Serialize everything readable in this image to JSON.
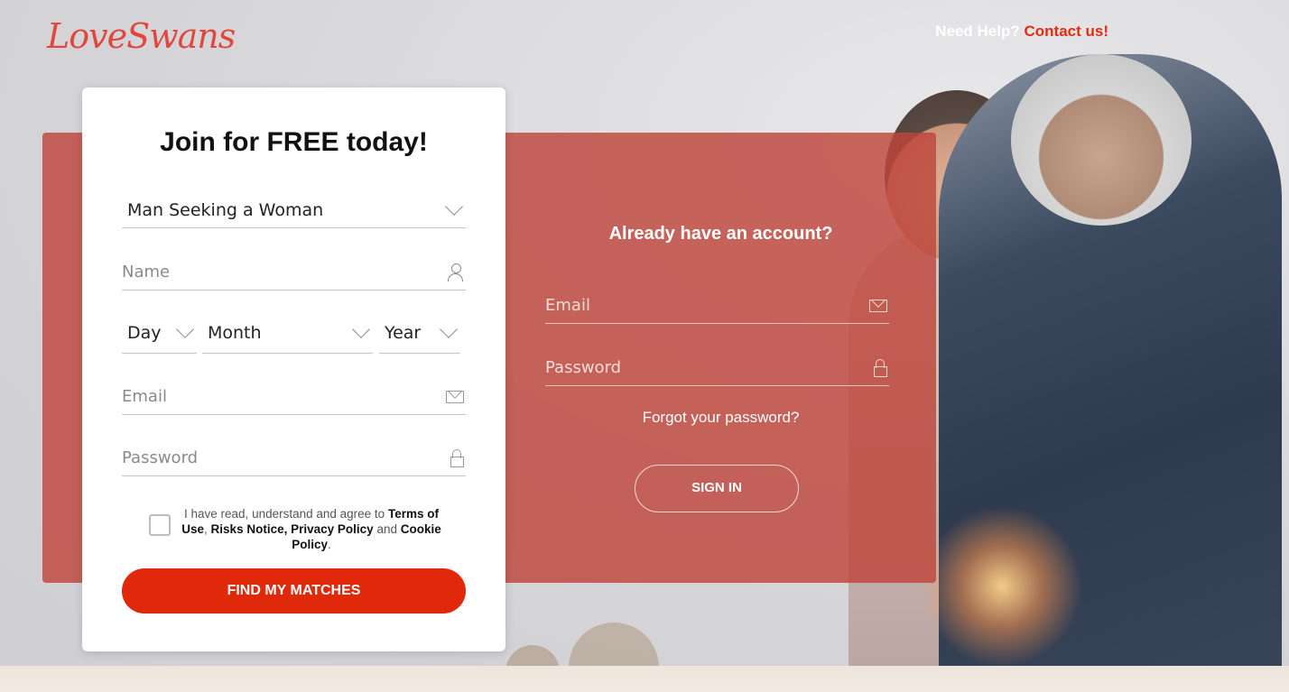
{
  "brand": {
    "logo_text": "LoveSwans"
  },
  "header": {
    "help_text": "Need Help?",
    "contact_link": "Contact us!"
  },
  "signup": {
    "title": "Join for FREE today!",
    "seeking_value": "Man Seeking a Woman",
    "name_placeholder": "Name",
    "day_value": "Day",
    "month_value": "Month",
    "year_value": "Year",
    "email_placeholder": "Email",
    "password_placeholder": "Password",
    "agree": {
      "prefix": "I have read, understand and agree to",
      "terms": "Terms of Use",
      "sep1": ",",
      "risks": "Risks Notice,",
      "privacy": "Privacy Policy",
      "and": "and",
      "cookie": "Cookie Policy",
      "end": "."
    },
    "submit_label": "FIND MY MATCHES"
  },
  "signin": {
    "title": "Already have an account?",
    "email_placeholder": "Email",
    "password_placeholder": "Password",
    "forgot_link": "Forgot your password?",
    "submit_label": "SIGN IN"
  },
  "colors": {
    "accent": "#e0280a",
    "logo": "#e1473e",
    "panel": "#be463c"
  }
}
